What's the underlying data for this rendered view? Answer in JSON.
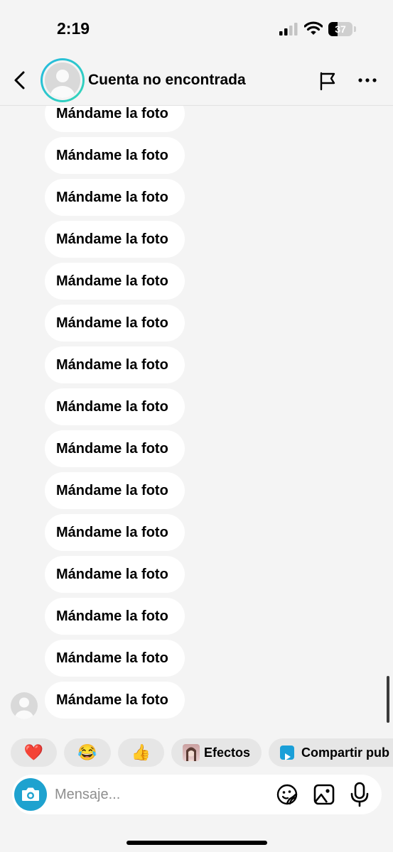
{
  "status_bar": {
    "time": "2:19",
    "battery": "37",
    "battery_level": 0.37
  },
  "header": {
    "title": "Cuenta no encontrada"
  },
  "messages": [
    "Mándame la foto",
    "Mándame la foto",
    "Mándame la foto",
    "Mándame la foto",
    "Mándame la foto",
    "Mándame la foto",
    "Mándame la foto",
    "Mándame la foto",
    "Mándame la foto",
    "Mándame la foto",
    "Mándame la foto",
    "Mándame la foto",
    "Mándame la foto",
    "Mándame la foto",
    "Mándame la foto"
  ],
  "quick_actions": {
    "heart": "❤️",
    "laugh": "😂",
    "thumbs_up": "👍",
    "effects": "Efectos",
    "share": "Compartir pub"
  },
  "composer": {
    "placeholder": "Mensaje..."
  },
  "colors": {
    "accent": "#1ea2cf",
    "bubble": "#ffffff",
    "background": "#f4f4f4",
    "chip": "#e6e6e6"
  },
  "icons": [
    "back-chevron-icon",
    "flag-icon",
    "more-icon",
    "camera-icon",
    "sticker-icon",
    "gallery-icon",
    "microphone-icon"
  ]
}
